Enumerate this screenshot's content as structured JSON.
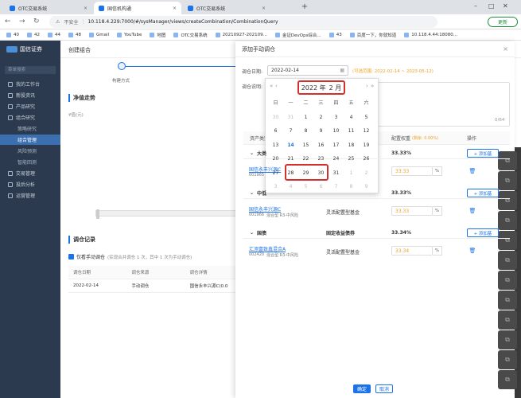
{
  "browser": {
    "tabs": [
      {
        "title": "OTC交易系统",
        "active": false
      },
      {
        "title": "国信机构通",
        "active": true
      },
      {
        "title": "OTC交易系统",
        "active": false
      }
    ],
    "security": "不安全",
    "url": "10.118.4.229:7000/#/sysManager/views/createCombination/CombinationQuery",
    "update_label": "更新",
    "bookmarks": [
      "40",
      "42",
      "44",
      "48",
      "Gmail",
      "YouTube",
      "地图",
      "OTC交易系统",
      "20210927-202109...",
      "金证DevOps综合...",
      "43",
      "百度一下，你就知道",
      "10.118.4.44:18080..."
    ]
  },
  "sidebar": {
    "logo": "国信证券",
    "search_placeholder": "菜单搜索",
    "items": [
      {
        "label": "我的工作台",
        "sub": false,
        "selected": false
      },
      {
        "label": "新股资讯",
        "sub": false,
        "selected": false
      },
      {
        "label": "产品研究",
        "sub": false,
        "selected": false
      },
      {
        "label": "组合研究",
        "sub": false,
        "selected": false
      },
      {
        "label": "策略研究",
        "sub": true,
        "selected": false
      },
      {
        "label": "组合管理",
        "sub": true,
        "selected": true
      },
      {
        "label": "风险预测",
        "sub": true,
        "selected": false
      },
      {
        "label": "智能回测",
        "sub": true,
        "selected": false
      },
      {
        "label": "交易管理",
        "sub": false,
        "selected": false
      },
      {
        "label": "投后分析",
        "sub": false,
        "selected": false
      },
      {
        "label": "运营管理",
        "sub": false,
        "selected": false
      }
    ]
  },
  "page": {
    "title": "创建组合",
    "step1": "构建方式",
    "net_value_title": "净值走势",
    "net_value_unit": "¥值(元)",
    "record_title": "调仓记录",
    "record_check_label": "仅看手动调仓",
    "record_check_note": "(实现合并调仓 1 次，其中 1 次为手动调仓)",
    "table_headers": [
      "调仓日期",
      "调仓来源",
      "调仓详情"
    ],
    "table_rows": [
      [
        "2022-02-14",
        "手动调仓",
        "国信永丰兴源C(0.0"
      ]
    ]
  },
  "modal": {
    "title": "添加手动调仓",
    "date_label": "调仓日期:",
    "date_value": "2022-02-14",
    "date_hint": "(可选范围: 2022-02-14 ~ 2023-05-12)",
    "note_label": "调仓说明:",
    "char_count": "0/64",
    "table_headers": [
      "资产类别",
      "配置权重",
      "操作"
    ],
    "weight_hint": "(剩余: 0.00%)",
    "groups": [
      {
        "name": "大类",
        "pct": "33.33%",
        "add_label": "+ 添加基",
        "funds": [
          {
            "name": "国信永丰兴源C",
            "code": "001965",
            "tags": "",
            "type": "",
            "weight": "33.33",
            "unit": "%"
          }
        ]
      },
      {
        "name": "中低",
        "pct": "33.33%",
        "add_label": "+ 添加基",
        "funds": [
          {
            "name": "国信永丰兴源C",
            "code": "001966",
            "tags": "混合型   R3-中风险",
            "type": "灵活配置型基金",
            "weight": "33.33",
            "unit": "%"
          }
        ]
      },
      {
        "name": "国债",
        "type_label": "固定收益债券",
        "pct": "33.34%",
        "add_label": "+ 添加基",
        "funds": [
          {
            "name": "汇添富致鑫混合A",
            "code": "002420",
            "tags": "混合型   R3-中风险",
            "type": "灵活配置型基金",
            "weight": "33.34",
            "unit": "%"
          }
        ]
      }
    ],
    "ok_label": "确定",
    "cancel_label": "取消"
  },
  "datepicker": {
    "year": "2022 年",
    "month": "2 月",
    "prev_year": "«",
    "prev_month": "‹",
    "next_month": "›",
    "next_year": "»",
    "weekdays": [
      "日",
      "一",
      "二",
      "三",
      "四",
      "五",
      "六"
    ],
    "weeks": [
      [
        [
          "30",
          "dim"
        ],
        [
          "31",
          "dim"
        ],
        [
          "1",
          ""
        ],
        [
          "2",
          ""
        ],
        [
          "3",
          ""
        ],
        [
          "4",
          ""
        ],
        [
          "5",
          ""
        ]
      ],
      [
        [
          "6",
          ""
        ],
        [
          "7",
          ""
        ],
        [
          "8",
          ""
        ],
        [
          "9",
          ""
        ],
        [
          "10",
          ""
        ],
        [
          "11",
          ""
        ],
        [
          "12",
          ""
        ]
      ],
      [
        [
          "13",
          ""
        ],
        [
          "14",
          "today"
        ],
        [
          "15",
          ""
        ],
        [
          "16",
          ""
        ],
        [
          "17",
          ""
        ],
        [
          "18",
          ""
        ],
        [
          "19",
          ""
        ]
      ],
      [
        [
          "20",
          ""
        ],
        [
          "21",
          ""
        ],
        [
          "22",
          ""
        ],
        [
          "23",
          ""
        ],
        [
          "24",
          ""
        ],
        [
          "25",
          ""
        ],
        [
          "26",
          ""
        ]
      ],
      [
        [
          "27",
          ""
        ],
        [
          "28",
          ""
        ],
        [
          "29",
          ""
        ],
        [
          "30",
          ""
        ],
        [
          "31",
          ""
        ],
        [
          "1",
          "dim"
        ],
        [
          "2",
          "dim"
        ]
      ],
      [
        [
          "3",
          "dim"
        ],
        [
          "4",
          "dim"
        ],
        [
          "5",
          "dim"
        ],
        [
          "6",
          "dim"
        ],
        [
          "7",
          "dim"
        ],
        [
          "8",
          "dim"
        ],
        [
          "9",
          "dim"
        ]
      ]
    ]
  }
}
